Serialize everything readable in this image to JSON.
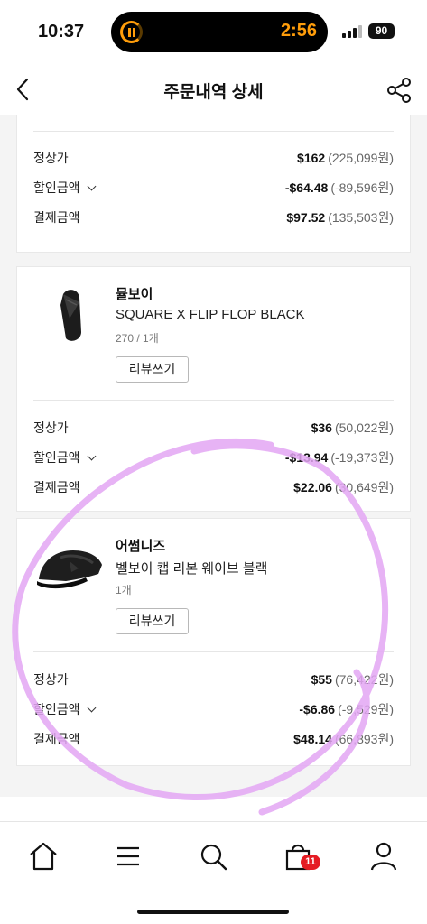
{
  "status_bar": {
    "time": "10:37",
    "timer": "2:56",
    "battery": "90",
    "accent_color": "#ff9d0a"
  },
  "header": {
    "title": "주문내역 상세",
    "back_icon": "chevron-left-icon",
    "share_icon": "share-icon"
  },
  "review_label": "리뷰쓰기",
  "price_labels": {
    "regular": "정상가",
    "discount": "할인금액",
    "paid": "결제금액"
  },
  "orders": [
    {
      "partial": true,
      "regular_usd": "$162",
      "regular_krw": "(225,099원)",
      "discount_usd": "-$64.48",
      "discount_krw": "(-89,596원)",
      "paid_usd": "$97.52",
      "paid_krw": "(135,503원)"
    },
    {
      "brand": "뮬보이",
      "name": "SQUARE X FLIP FLOP BLACK",
      "option": "270 / 1개",
      "thumb_icon": "flip-flop-icon",
      "regular_usd": "$36",
      "regular_krw": "(50,022원)",
      "discount_usd": "-$13.94",
      "discount_krw": "(-19,373원)",
      "paid_usd": "$22.06",
      "paid_krw": "(30,649원)"
    },
    {
      "brand": "어썸니즈",
      "name": "벨보이 캡 리본 웨이브 블랙",
      "option": "1개",
      "thumb_icon": "cap-icon",
      "regular_usd": "$55",
      "regular_krw": "(76,422원)",
      "discount_usd": "-$6.86",
      "discount_krw": "(-9,529원)",
      "paid_usd": "$48.14",
      "paid_krw": "(66,893원)"
    }
  ],
  "bottom_nav": {
    "items": [
      "home-icon",
      "menu-icon",
      "search-icon",
      "shopping-bag-icon",
      "profile-icon"
    ],
    "cart_badge": "11",
    "badge_color": "#e51c23"
  },
  "annotation_color": "#e3a6f3"
}
